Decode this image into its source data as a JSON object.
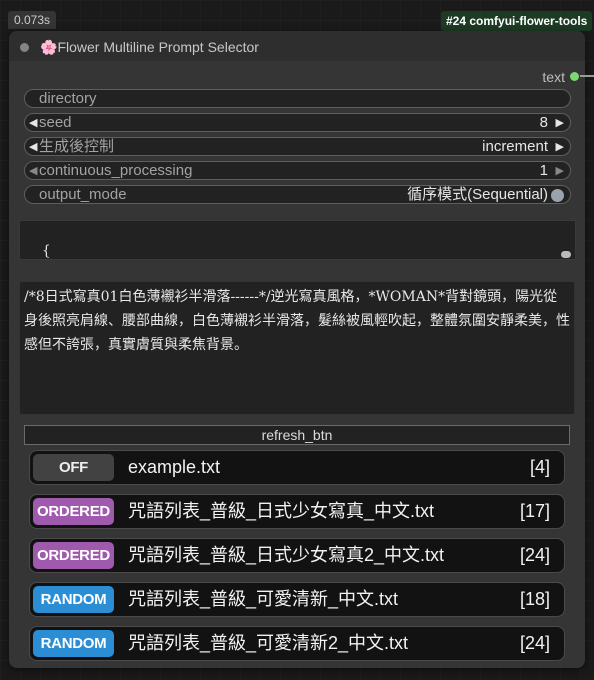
{
  "timing": "0.073s",
  "node_badge": "#24 comfyui-flower-tools",
  "node": {
    "title_icon": "🌸",
    "title": "Flower Multiline Prompt Selector",
    "output": "text"
  },
  "widgets": {
    "directory": {
      "label": "directory"
    },
    "seed": {
      "label": "seed",
      "value": "8"
    },
    "control_after_generate": {
      "label": "生成後控制",
      "value": "increment"
    },
    "continuous_processing": {
      "label": "continuous_processing",
      "value": "1"
    },
    "output_mode": {
      "label": "output_mode",
      "value": "循序模式(Sequential)"
    }
  },
  "json_text": "{\n  \"example.txt\": {",
  "prompt_text": "/*8日式寫真01白色薄襯衫半滑落------*/逆光寫真風格，*WOMAN*背對鏡頭，陽光從身後照亮肩線、腰部曲線，白色薄襯衫半滑落，髮絲被風輕吹起，整體氛圍安靜柔美，性感但不誇張，真實膚質與柔焦背景。",
  "refresh_label": "refresh_btn",
  "files": [
    {
      "mode": "OFF",
      "name": "example.txt",
      "count": "[4]"
    },
    {
      "mode": "ORDERED",
      "name": "咒語列表_普級_日式少女寫真_中文.txt",
      "count": "[17]"
    },
    {
      "mode": "ORDERED",
      "name": "咒語列表_普級_日式少女寫真2_中文.txt",
      "count": "[24]"
    },
    {
      "mode": "RANDOM",
      "name": "咒語列表_普級_可愛清新_中文.txt",
      "count": "[18]"
    },
    {
      "mode": "RANDOM",
      "name": "咒語列表_普級_可愛清新2_中文.txt",
      "count": "[24]"
    }
  ],
  "colors": {
    "ordered": "#9f5aad",
    "random": "#2b8ed4",
    "off": "#424242",
    "output_dot": "#7bd870"
  }
}
